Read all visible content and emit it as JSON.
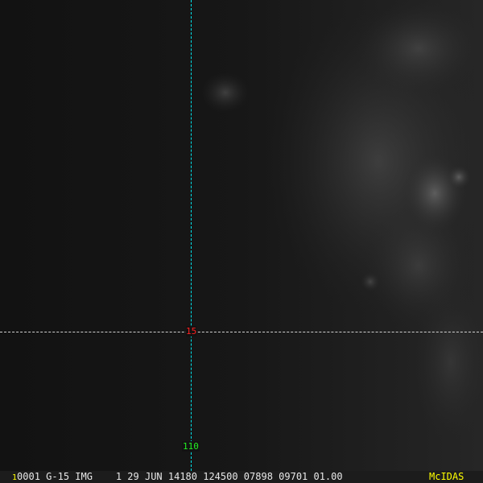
{
  "overlay": {
    "latitude_label": "15",
    "longitude_label": "110",
    "latitude_color": "#ff2020",
    "longitude_color": "#22ee22",
    "gridline_color": "#00e5ee"
  },
  "status_bar": {
    "frame_number": "1",
    "info": "0001 G-15 IMG    1 29 JUN 14180 124500 07898 09701 01.00",
    "brand": "McIDAS"
  }
}
